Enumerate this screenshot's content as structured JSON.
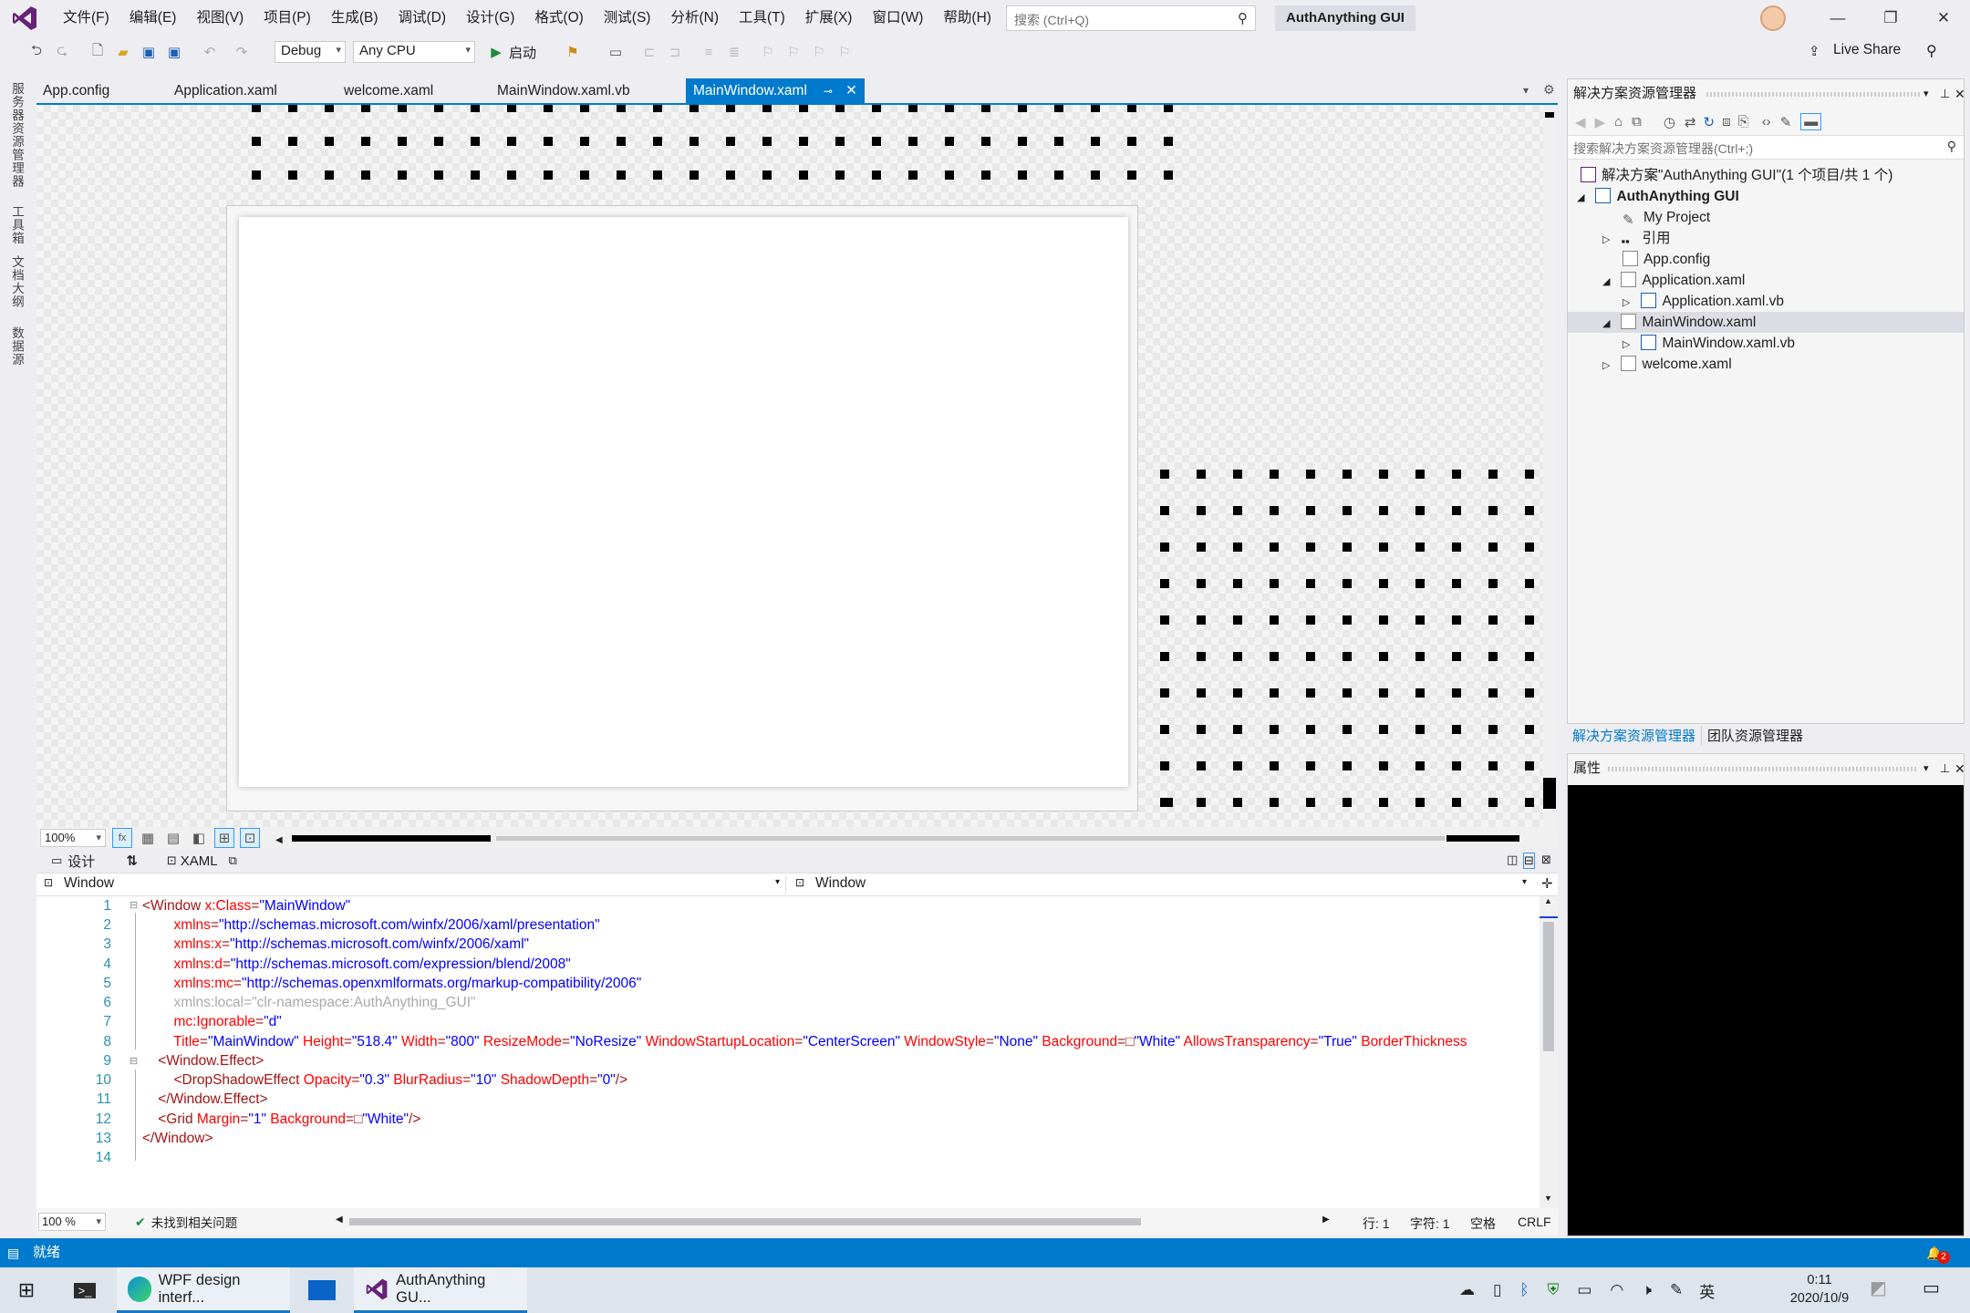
{
  "menu": [
    "文件(F)",
    "编辑(E)",
    "视图(V)",
    "项目(P)",
    "生成(B)",
    "调试(D)",
    "设计(G)",
    "格式(O)",
    "测试(S)",
    "分析(N)",
    "工具(T)",
    "扩展(X)",
    "窗口(W)",
    "帮助(H)"
  ],
  "search_placeholder": "搜索 (Ctrl+Q)",
  "app_title": "AuthAnything GUI",
  "toolbar": {
    "config": "Debug",
    "platform": "Any CPU",
    "start_label": "启动",
    "live_share": "Live Share"
  },
  "left_tabs": [
    "服务器资源管理器",
    "工具箱",
    "文档大纲",
    "数据源"
  ],
  "doc_tabs": [
    "App.config",
    "Application.xaml",
    "welcome.xaml",
    "MainWindow.xaml.vb",
    "MainWindow.xaml"
  ],
  "designer": {
    "zoom": "100%"
  },
  "split": {
    "design_label": "设计",
    "xaml_label": "XAML"
  },
  "nav": {
    "left": "Window",
    "right": "Window"
  },
  "code_lines": [
    "1",
    "2",
    "3",
    "4",
    "5",
    "6",
    "7",
    "8",
    "9",
    "10",
    "11",
    "12",
    "13",
    "14"
  ],
  "code_status": {
    "zoom": "100 %",
    "issues": "未找到相关问题",
    "row": "行: 1",
    "char": "字符: 1",
    "spaces": "空格",
    "eol": "CRLF"
  },
  "solution": {
    "title": "解决方案资源管理器",
    "search_placeholder": "搜索解决方案资源管理器(Ctrl+;)",
    "items": [
      "解决方案\"AuthAnything GUI\"(1 个项目/共 1 个)",
      "AuthAnything GUI",
      "My Project",
      "引用",
      "App.config",
      "Application.xaml",
      "Application.xaml.vb",
      "MainWindow.xaml",
      "MainWindow.xaml.vb",
      "welcome.xaml"
    ],
    "bottom_tabs": [
      "解决方案资源管理器",
      "团队资源管理器"
    ]
  },
  "properties": {
    "title": "属性"
  },
  "status_text": "就绪",
  "notify_count": "2",
  "taskbar": {
    "edge": "WPF design interf...",
    "vs": "AuthAnything GU...",
    "ime": "英",
    "time": "0:11",
    "date": "2020/10/9"
  }
}
